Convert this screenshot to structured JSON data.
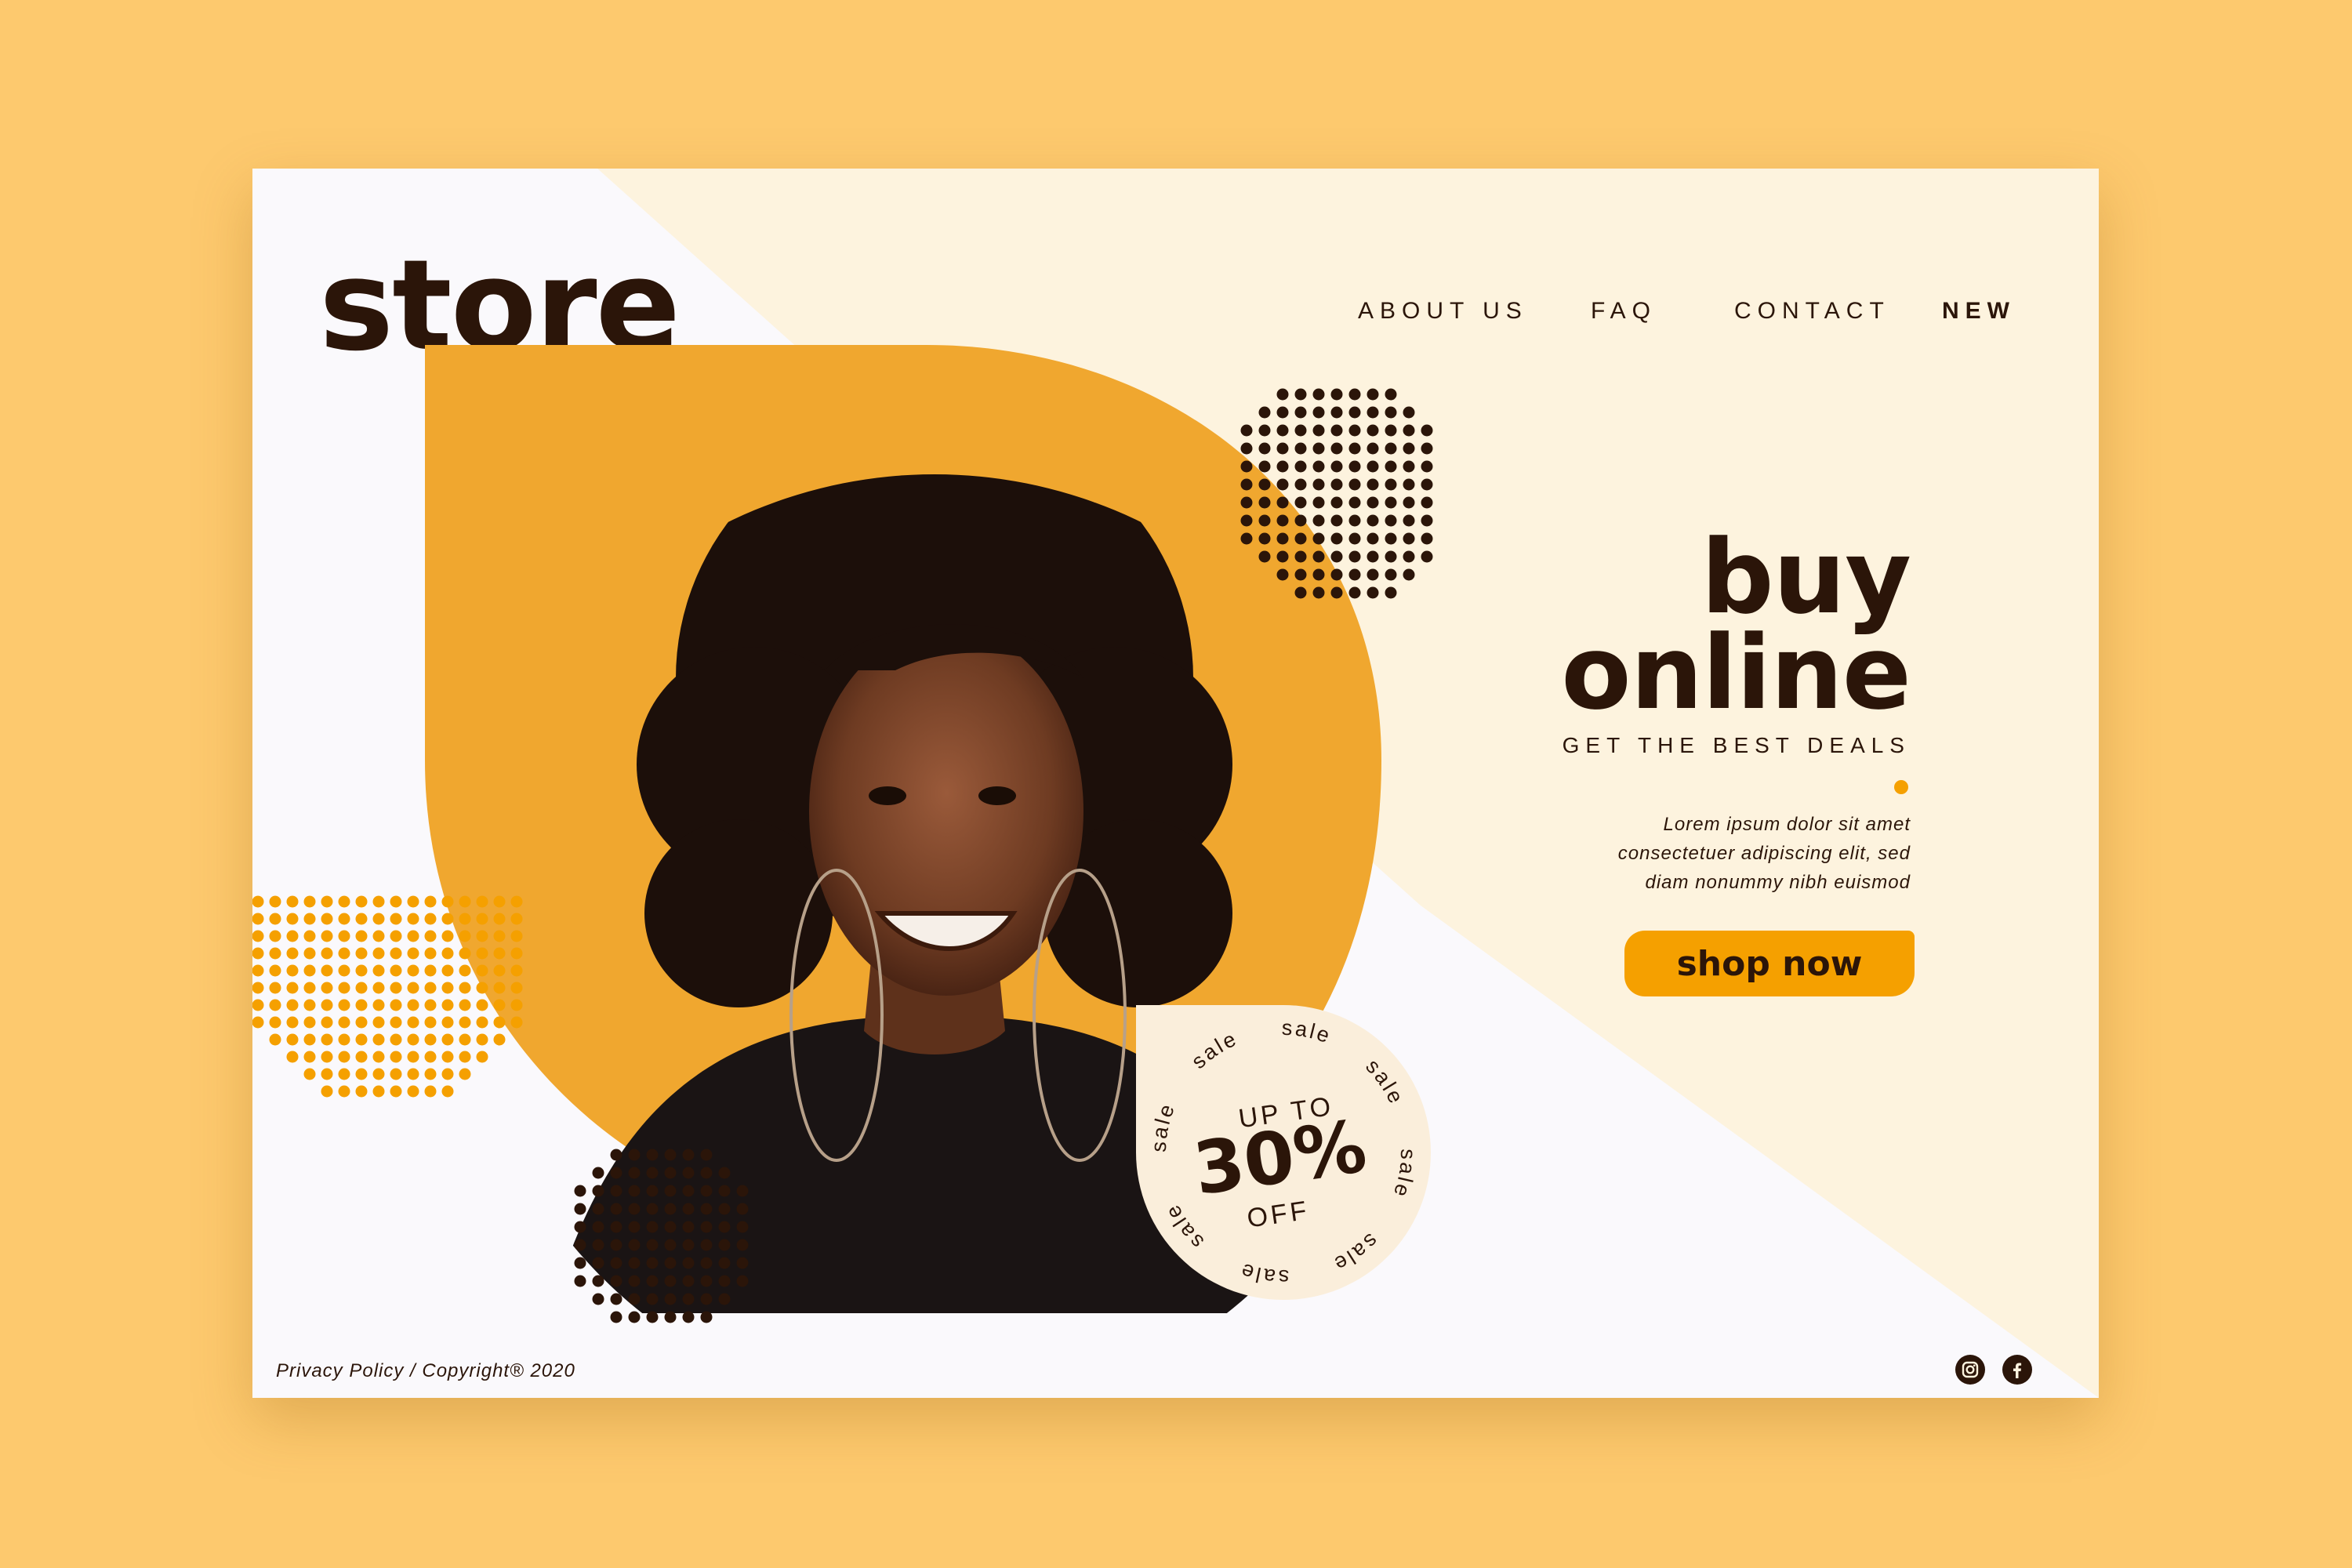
{
  "brand": {
    "logo": "store"
  },
  "nav": {
    "items": [
      {
        "label": "ABOUT US",
        "bold": false
      },
      {
        "label": "FAQ",
        "bold": false
      },
      {
        "label": "CONTACT",
        "bold": false
      },
      {
        "label": "NEW",
        "bold": true
      }
    ]
  },
  "hero": {
    "headline_line1": "buy",
    "headline_line2": "online",
    "tagline": "GET THE BEST DEALS",
    "description_line1": "Lorem ipsum dolor sit amet",
    "description_line2": "consectetuer adipiscing elit, sed",
    "description_line3": "diam nonummy nibh euismod",
    "cta": "shop now",
    "image": "smiling-woman-portrait"
  },
  "badge": {
    "ring_word": "sale",
    "line1": "UP TO",
    "value": "30%",
    "line2": "OFF"
  },
  "footer": {
    "text": "Privacy Policy / Copyright® 2020",
    "social_icons": [
      "instagram-icon",
      "facebook-icon"
    ]
  },
  "colors": {
    "outer_background": "#fdc96e",
    "page_cream": "#fdf3de",
    "page_white": "#faf9fc",
    "accent_orange": "#f5a000",
    "blob_orange": "#f0a72f",
    "text_dark": "#2b1509"
  }
}
